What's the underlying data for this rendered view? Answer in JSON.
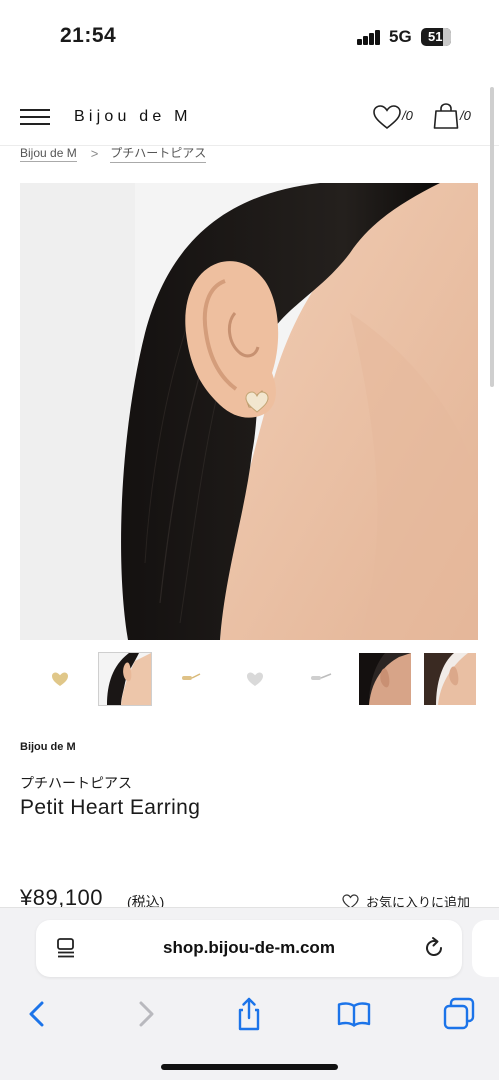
{
  "status_bar": {
    "time": "21:54",
    "network": "5G",
    "battery": "51"
  },
  "header": {
    "brand": "Bijou de M",
    "favorites_count": "/0",
    "cart_count": "/0",
    "icons": [
      "menu-icon",
      "heart-icon",
      "shopping-bag-icon"
    ]
  },
  "breadcrumb": {
    "home": "Bijou de M",
    "separator": ">",
    "current": "プチハートピアス"
  },
  "gallery": {
    "thumbnails": [
      {
        "label": "gold heart earring"
      },
      {
        "label": "model ear side view",
        "active": true
      },
      {
        "label": "gold earring side view"
      },
      {
        "label": "silver heart earring"
      },
      {
        "label": "silver earring side view"
      },
      {
        "label": "model ear dark background"
      },
      {
        "label": "model ear close up"
      }
    ]
  },
  "product": {
    "brand": "Bijou de M",
    "name_jp": "プチハートピアス",
    "name_en": "Petit Heart Earring",
    "price": "¥89,100",
    "tax_note": "(税込)",
    "favorite_label": "お気に入りに追加"
  },
  "browser": {
    "url": "shop.bijou-de-m.com",
    "toolbar": [
      "back-icon",
      "forward-icon",
      "share-icon",
      "bookmarks-icon",
      "tabs-icon"
    ]
  },
  "colors": {
    "accent_blue": "#1c74e9",
    "disabled_gray": "#b9b9be",
    "text": "#1a1a1a"
  }
}
